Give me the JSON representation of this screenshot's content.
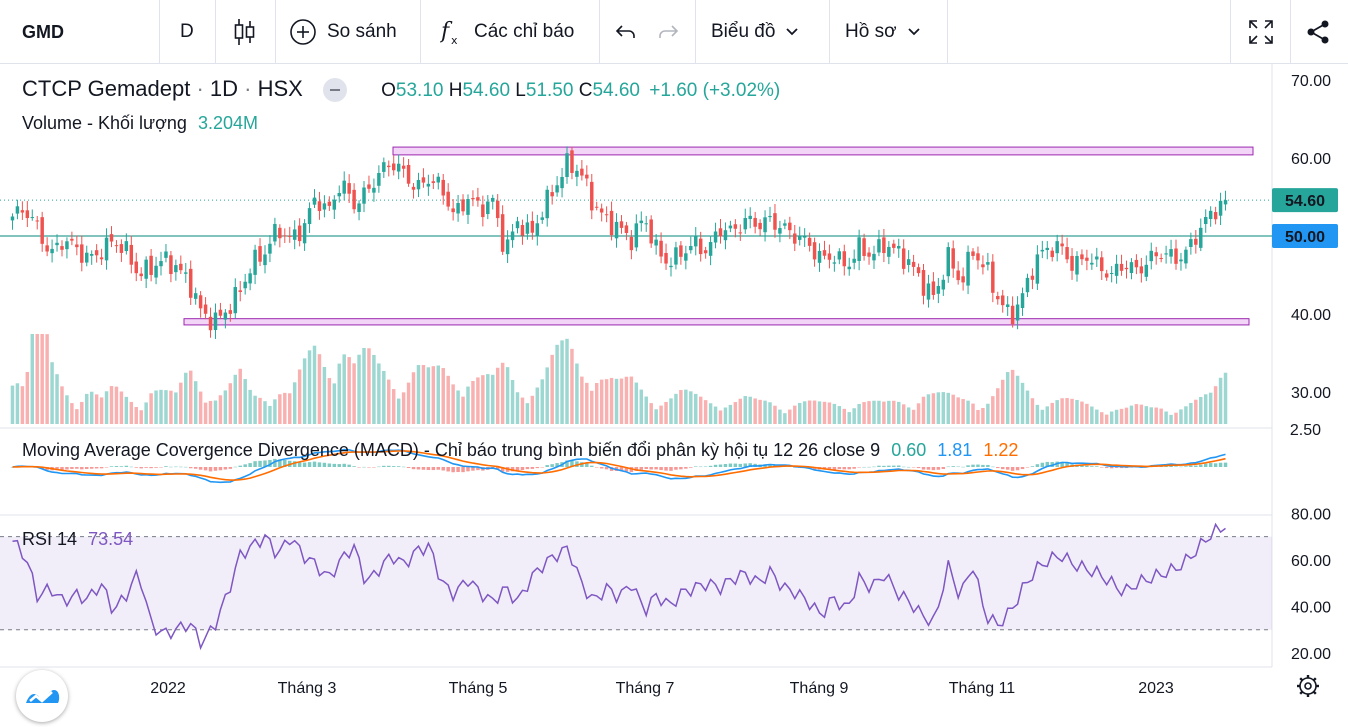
{
  "toolbar": {
    "symbol": "GMD",
    "interval": "D",
    "compare_label": "So sánh",
    "indicators_label": "Các chỉ báo",
    "chart_label": "Biểu đồ",
    "profile_label": "Hồ sơ"
  },
  "legend": {
    "name": "CTCP Gemadept",
    "interval": "1D",
    "exchange": "HSX",
    "o_label": "O",
    "o": "53.10",
    "h_label": "H",
    "h": "54.60",
    "l_label": "L",
    "l": "51.50",
    "c_label": "C",
    "c": "54.60",
    "change": "+1.60 (+3.02%)",
    "volume_label": "Volume - Khối lượng",
    "volume_value": "3.204M",
    "macd_label": "Moving Average Covergence Divergence (MACD) - Chỉ báo trung bình biến đổi phân kỳ hội tụ",
    "macd_params": "12 26 close 9",
    "macd_hist": "0.60",
    "macd_line": "1.81",
    "macd_signal": "1.22",
    "rsi_label": "RSI",
    "rsi_period": "14",
    "rsi_value": "73.54"
  },
  "colors": {
    "up": "#26a69a",
    "down": "#ef5350",
    "macd_line": "#2196f3",
    "macd_signal": "#ff6d00",
    "rsi": "#7e57c2",
    "box_border": "#9c27b0",
    "box_fill": "#f3d6f7",
    "horizontal_line": "#00897b",
    "last_price_bg": "#26a69a",
    "level_bg": "#2196f3"
  },
  "chart_data": {
    "type": "candlestick",
    "price_axis": {
      "ticks": [
        "70.00",
        "60.00",
        "40.00",
        "30.00"
      ],
      "range": [
        28,
        71
      ]
    },
    "macd_axis": {
      "ticks": [
        "2.50"
      ]
    },
    "rsi_axis": {
      "ticks": [
        "80.00",
        "60.00",
        "40.00",
        "20.00"
      ],
      "range": [
        18,
        82
      ],
      "bands": [
        30,
        70
      ]
    },
    "time_labels": [
      "2022",
      "Tháng 3",
      "Tháng 5",
      "Tháng 7",
      "Tháng 9",
      "Tháng 11",
      "2023"
    ],
    "last_price": "54.60",
    "level_price": "50.00",
    "resistance_band": [
      60.4,
      61.4
    ],
    "support_band": [
      38.6,
      39.4
    ],
    "close_path": [
      52.5,
      53.5,
      51,
      47.5,
      49.5,
      48.5,
      47,
      48,
      49.5,
      48,
      45,
      46,
      47,
      46,
      44,
      40,
      39,
      40.5,
      43,
      46.5,
      48,
      51,
      49.5,
      51,
      55,
      53,
      57,
      54,
      55.5,
      58,
      59.5,
      58,
      56,
      57.5,
      56,
      52.5,
      55,
      53.5,
      54.5,
      48,
      52,
      50,
      53.5,
      56.5,
      59.5,
      58,
      54,
      52,
      51,
      49.5,
      52.5,
      48,
      46.5,
      48,
      49,
      48,
      51,
      50.5,
      52,
      51.5,
      52,
      51,
      50,
      49,
      47,
      47.5,
      46,
      48.5,
      47.5,
      49,
      48,
      46.5,
      44,
      42,
      47.5,
      44,
      48,
      46,
      42,
      39.5,
      42.5,
      47,
      48.5,
      48.5,
      46,
      47.5,
      46,
      45,
      46.5,
      45.5,
      47,
      48,
      47,
      48,
      51,
      53.1,
      54.6
    ],
    "volume_path": [
      4,
      2,
      7,
      3,
      2,
      1.5,
      2,
      1.2,
      1.8,
      1.5,
      1.3,
      2,
      1.6,
      1.4,
      3,
      2.5,
      1.5,
      1.7,
      2.5,
      1.5,
      1.8,
      2,
      1.5,
      2.8,
      4,
      3.5,
      5,
      3,
      3.5,
      3,
      2.8,
      2.5,
      3,
      2.5,
      2.8,
      2.5,
      3,
      2.5,
      2.2,
      3,
      2,
      2.2,
      2.5,
      3.5,
      4,
      3,
      3.5,
      2.5,
      2,
      2.2,
      1.8,
      1.5,
      1.4,
      1.6,
      1.4,
      1.3,
      1.4,
      1.2,
      1.3,
      1.1,
      1.2,
      1.1,
      1.2,
      1.1,
      1,
      1.1,
      1.2,
      1.3,
      1.1,
      1,
      1.2,
      1.3,
      1.8,
      1.5,
      1.4,
      1.3,
      1.6,
      1.2,
      1.8,
      2.5,
      2,
      1.5,
      1.4,
      1.3,
      1.1,
      1,
      0.9,
      1,
      0.8,
      0.9,
      0.8,
      1,
      0.9,
      1,
      1.2,
      1.5,
      3.2
    ],
    "rsi_path": [
      68,
      62,
      44,
      48,
      42,
      45,
      43,
      50,
      38,
      45,
      55,
      32,
      28,
      30,
      33,
      24,
      32,
      45,
      62,
      66,
      70,
      62,
      70,
      62,
      58,
      52,
      60,
      66,
      50,
      56,
      62,
      58,
      64,
      66,
      50,
      45,
      52,
      46,
      42,
      48,
      42,
      52,
      58,
      62,
      65,
      50,
      42,
      48,
      44,
      50,
      38,
      45,
      40,
      46,
      48,
      50,
      48,
      52,
      54,
      50,
      55,
      48,
      46,
      42,
      36,
      44,
      38,
      52,
      48,
      54,
      46,
      42,
      36,
      33,
      58,
      44,
      58,
      36,
      32,
      38,
      48,
      56,
      60,
      62,
      58,
      56,
      54,
      50,
      46,
      50,
      52,
      54,
      56,
      60,
      66,
      72,
      73.5
    ]
  }
}
